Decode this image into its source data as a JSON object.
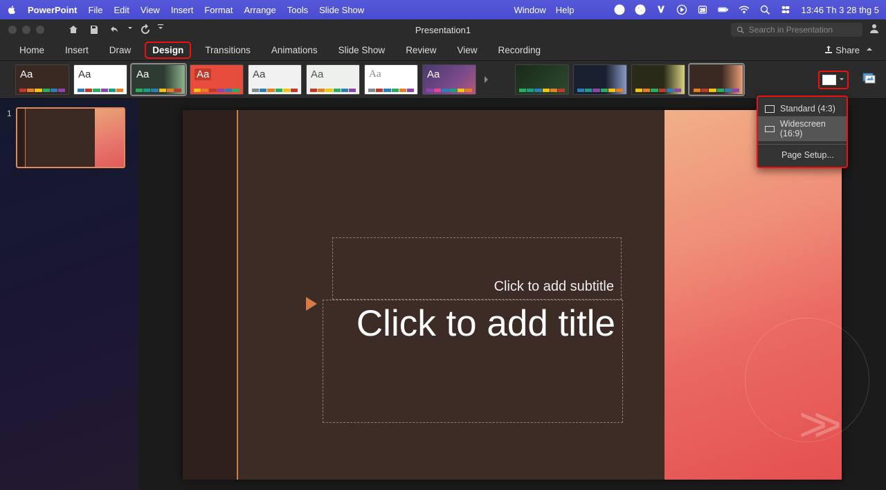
{
  "mac_menu": {
    "app_name": "PowerPoint",
    "items": [
      "File",
      "Edit",
      "View",
      "Insert",
      "Format",
      "Arrange",
      "Tools",
      "Slide Show"
    ],
    "right_items": [
      "Window",
      "Help"
    ],
    "clock": "13:46 Th 3 28 thg 5"
  },
  "title_bar": {
    "document_title": "Presentation1",
    "search_placeholder": "Search in Presentation"
  },
  "ribbon": {
    "tabs": [
      "Home",
      "Insert",
      "Draw",
      "Design",
      "Transitions",
      "Animations",
      "Slide Show",
      "Review",
      "View",
      "Recording"
    ],
    "active_tab": "Design",
    "share_label": "Share"
  },
  "themes_row": {
    "aa_label": "Aa"
  },
  "size_menu": {
    "standard": "Standard (4:3)",
    "widescreen": "Widescreen (16:9)",
    "page_setup": "Page Setup..."
  },
  "slide_panel": {
    "slide_number": "1"
  },
  "canvas": {
    "subtitle_placeholder": "Click to add subtitle",
    "title_placeholder": "Click to add title"
  }
}
